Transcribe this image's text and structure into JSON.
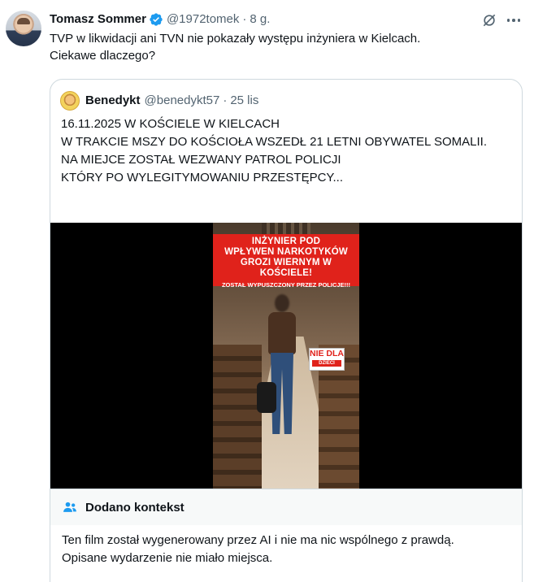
{
  "author": {
    "name": "Tomasz Sommer",
    "handle": "@1972tomek",
    "separator": "·",
    "time": "8 g."
  },
  "tweet": {
    "text": "TVP w likwidacji ani TVN nie pokazały występu inżyniera w Kielcach.\nCiekawe dlaczego?"
  },
  "quote": {
    "author": {
      "name": "Benedykt",
      "handle": "@benedykt57",
      "separator": "·",
      "time": "25 lis"
    },
    "text": "16.11.2025 W KOŚCIELE W KIELCACH\nW TRAKCIE MSZY DO KOŚCIOŁA WSZEDŁ 21 LETNI OBYWATEL SOMALII.\nNA MIEJCE ZOSTAŁ WEZWANY PATROL POLICJI\nKTÓRY PO WYLEGITYMOWANIU PRZESTĘPCY...",
    "video": {
      "banner_title": "INŻYNIER POD\nWPŁYWEN NARKOTYKÓW\nGROZI WIERNYM W KOŚCIELE!",
      "banner_subtitle": "ZOSTAŁ WYPUSZCZONY PRZEZ POLICJE!!!",
      "sticker_main": "NIE DLA",
      "sticker_sub": "DZIECI"
    }
  },
  "context": {
    "label": "Dodano kontekst",
    "text": "Ten film został wygenerowany przez AI i nie ma nic wspólnego z prawdą.\nOpisane wydarzenie nie miało miejsca."
  },
  "colors": {
    "text": "#0f1419",
    "secondary": "#536471",
    "verified": "#1d9bf0",
    "border": "#cfd9de",
    "banner_red": "#e0221b"
  },
  "icons": [
    "verified-badge-icon",
    "grok-icon",
    "more-icon",
    "people-icon"
  ]
}
